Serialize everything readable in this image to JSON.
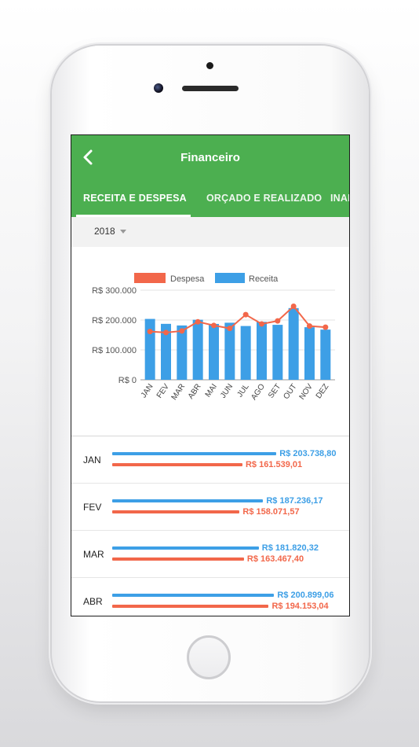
{
  "app": {
    "title": "Financeiro",
    "tabs": [
      {
        "label": "RECEITA E DESPESA",
        "active": true
      },
      {
        "label": "ORÇADO E REALIZADO",
        "active": false
      },
      {
        "label": "INAD",
        "active": false
      }
    ],
    "year": "2018"
  },
  "colors": {
    "primary": "#4caf50",
    "receita": "#3d9fe6",
    "despesa": "#f2674a"
  },
  "chart_data": {
    "type": "bar",
    "categories": [
      "JAN",
      "FEV",
      "MAR",
      "ABR",
      "MAI",
      "JUN",
      "JUL",
      "AGO",
      "SET",
      "OUT",
      "NOV",
      "DEZ"
    ],
    "series": [
      {
        "name": "Receita",
        "kind": "bar",
        "values": [
          203738.8,
          187236.17,
          181820.32,
          200899.06,
          187000,
          191000,
          180000,
          194000,
          184000,
          240000,
          176000,
          168000
        ]
      },
      {
        "name": "Despesa",
        "kind": "line",
        "values": [
          161539.01,
          158071.57,
          163467.4,
          194153.04,
          182000,
          172000,
          218000,
          187000,
          197000,
          246000,
          180000,
          176000
        ]
      }
    ],
    "ytick_labels": [
      "R$ 0",
      "R$ 100.000",
      "R$ 200.000",
      "R$ 300.000"
    ],
    "ylim": [
      0,
      300000
    ],
    "legend": "top-center",
    "grid": true
  },
  "rows": [
    {
      "month": "JAN",
      "receita": "R$ 203.738,80",
      "despesa": "R$ 161.539,01",
      "receita_value": 203738.8,
      "despesa_value": 161539.01
    },
    {
      "month": "FEV",
      "receita": "R$ 187.236,17",
      "despesa": "R$ 158.071,57",
      "receita_value": 187236.17,
      "despesa_value": 158071.57
    },
    {
      "month": "MAR",
      "receita": "R$ 181.820,32",
      "despesa": "R$ 163.467,40",
      "receita_value": 181820.32,
      "despesa_value": 163467.4
    },
    {
      "month": "ABR",
      "receita": "R$ 200.899,06",
      "despesa": "R$ 194.153,04",
      "receita_value": 200899.06,
      "despesa_value": 194153.04
    }
  ]
}
